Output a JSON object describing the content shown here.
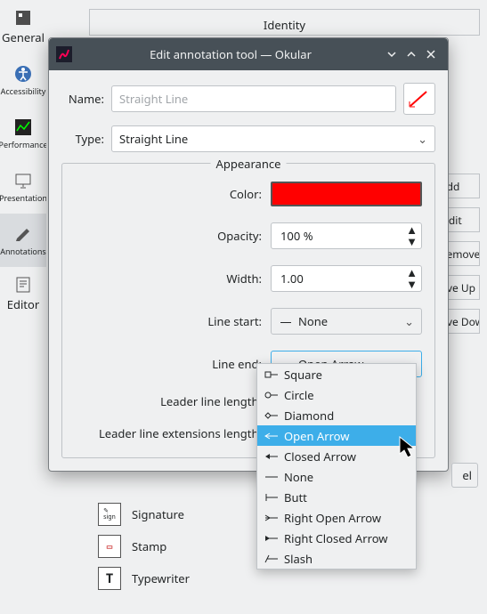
{
  "background": {
    "sidebar": [
      {
        "label": "General"
      },
      {
        "label": "Accessibility"
      },
      {
        "label": "Performance"
      },
      {
        "label": "Presentation"
      },
      {
        "label": "Annotations"
      },
      {
        "label": "Editor"
      }
    ],
    "identity": "Identity",
    "buttons": [
      "+  Add",
      "✎  Edit",
      "−  Remove",
      "Move Up",
      "Move Down"
    ],
    "listItems": [
      {
        "label": "Signature"
      },
      {
        "label": "Stamp"
      },
      {
        "label": "Typewriter"
      }
    ]
  },
  "dialog": {
    "title": "Edit annotation tool — Okular",
    "nameLabel": "Name:",
    "namePlaceholder": "Straight Line",
    "typeLabel": "Type:",
    "typeValue": "Straight Line",
    "group": {
      "title": "Appearance",
      "colorLabel": "Color:",
      "colorValue": "#ff0000",
      "opacityLabel": "Opacity:",
      "opacityValue": "100 %",
      "widthLabel": "Width:",
      "widthValue": "1.00",
      "lineStartLabel": "Line start:",
      "lineStartValue": "None",
      "lineEndLabel": "Line end:",
      "lineEndValue": "Open Arrow",
      "leaderLenLabel": "Leader line length:",
      "leaderExtLabel": "Leader line extensions length:"
    },
    "dropdown": {
      "options": [
        "Square",
        "Circle",
        "Diamond",
        "Open Arrow",
        "Closed Arrow",
        "None",
        "Butt",
        "Right Open Arrow",
        "Right Closed Arrow",
        "Slash"
      ],
      "highlighted": "Open Arrow"
    },
    "cancelFragment": "el"
  }
}
